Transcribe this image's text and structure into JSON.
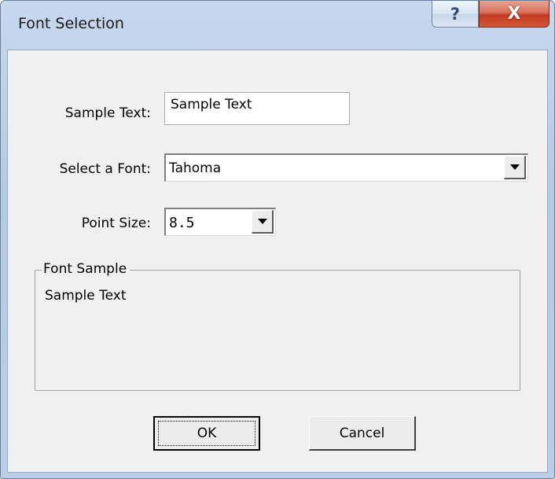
{
  "window": {
    "title": "Font Selection",
    "help_glyph": "?",
    "close_glyph": "X"
  },
  "form": {
    "sample_text_label": "Sample Text:",
    "sample_text_value": "Sample Text",
    "font_label": "Select a Font:",
    "font_value": "Tahoma",
    "size_label": "Point Size:",
    "size_value": "8.5"
  },
  "preview": {
    "group_label": "Font Sample",
    "sample": "Sample Text"
  },
  "buttons": {
    "ok": "OK",
    "cancel": "Cancel"
  },
  "icons": {
    "help": "question-mark-icon",
    "close": "close-x-icon",
    "dropdown": "chevron-down-icon"
  },
  "colors": {
    "frame": "#b9cfe7",
    "close_button": "#c23a1f",
    "dialog_face": "#f0f0f0"
  }
}
